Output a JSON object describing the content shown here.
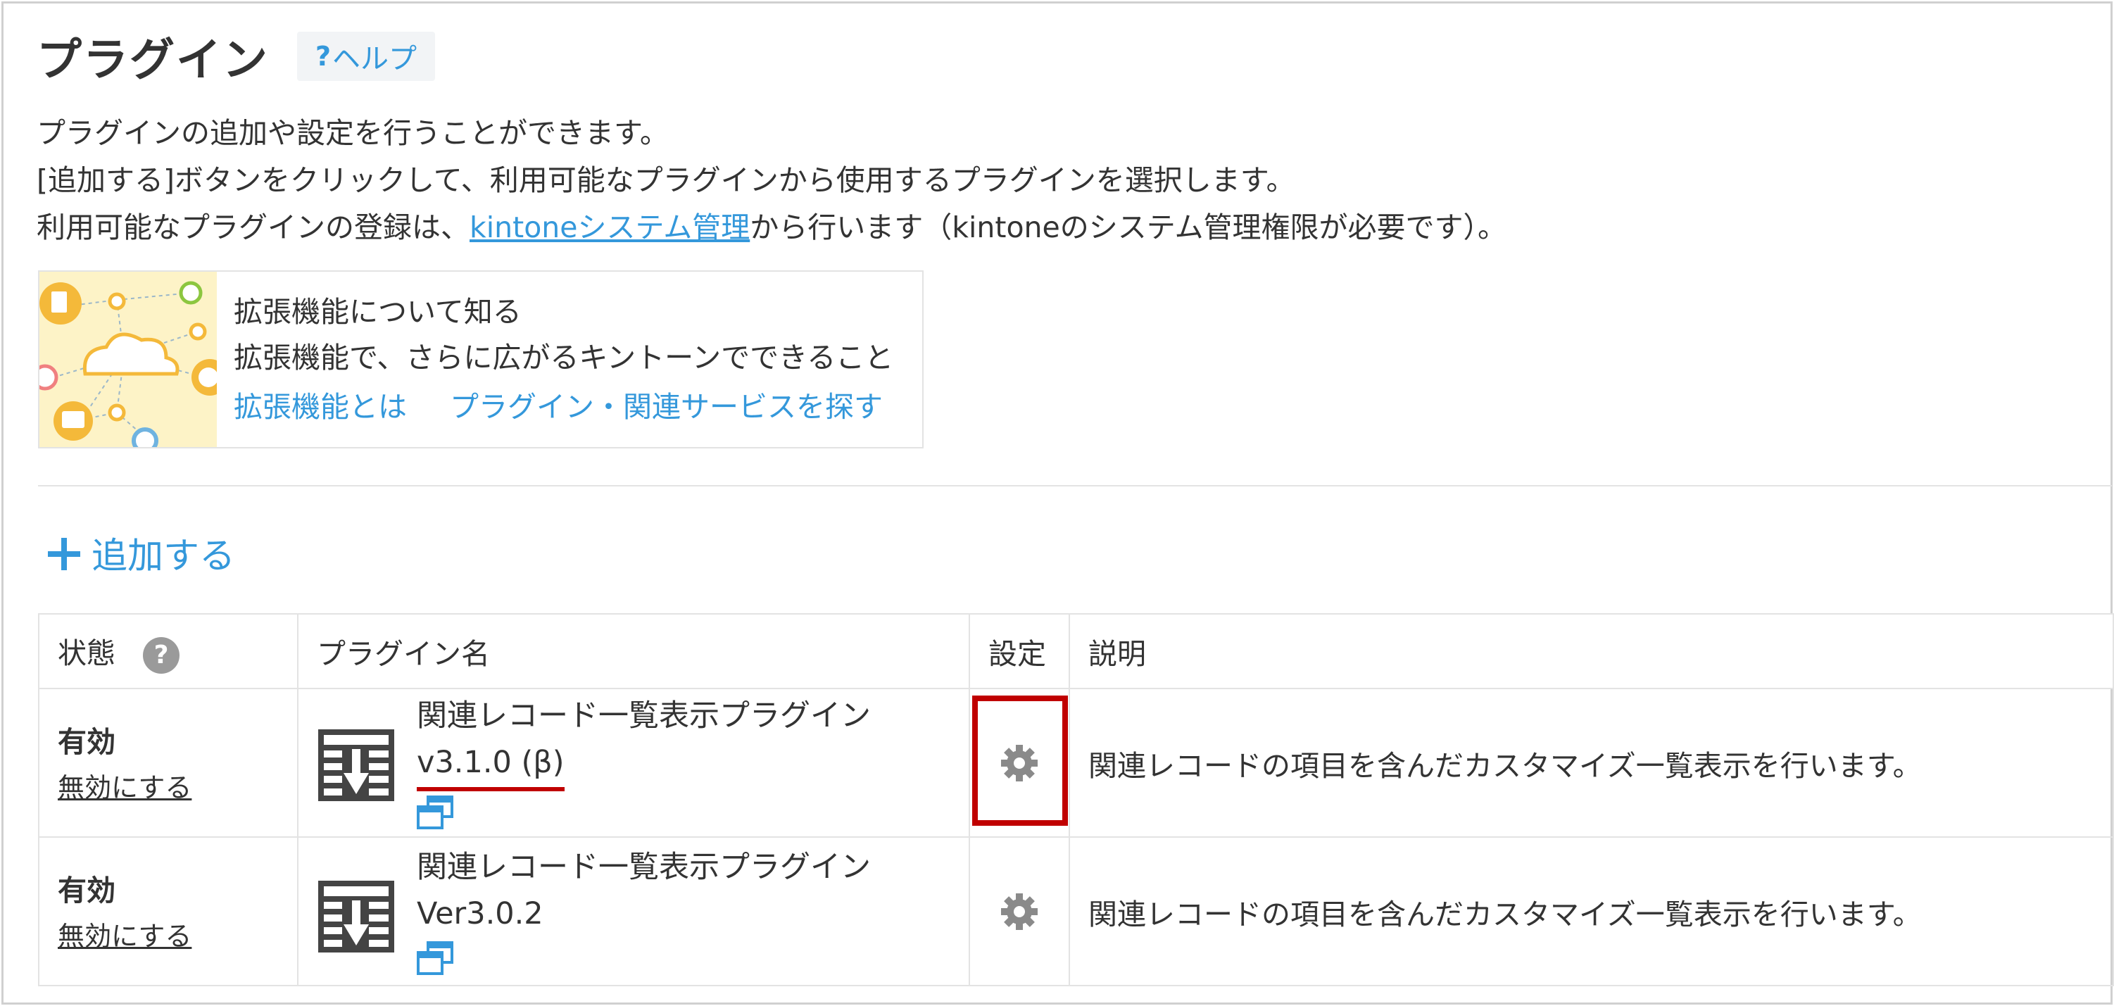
{
  "header": {
    "title": "プラグイン",
    "help_q": "?",
    "help_label": "ヘルプ"
  },
  "intro": {
    "line1": "プラグインの追加や設定を行うことができます。",
    "line2": "[追加する]ボタンをクリックして、利用可能なプラグインから使用するプラグインを選択します。",
    "line3_prefix": "利用可能なプラグインの登録は、",
    "line3_link": "kintoneシステム管理",
    "line3_suffix": "から行います（kintoneのシステム管理権限が必要です）。"
  },
  "extension": {
    "title": "拡張機能について知る",
    "subtitle": "拡張機能で、さらに広がるキントーンでできること",
    "link1": "拡張機能とは",
    "link2": "プラグイン・関連サービスを探す"
  },
  "add_button": {
    "label": "追加する"
  },
  "table": {
    "headers": {
      "status": "状態",
      "status_help": "?",
      "name": "プラグイン名",
      "setting": "設定",
      "description": "説明"
    },
    "rows": [
      {
        "status": "有効",
        "toggle": "無効にする",
        "name": "関連レコード一覧表示プラグイン",
        "version": "v3.1.0 (β)",
        "description": "関連レコードの項目を含んだカスタマイズ一覧表示を行います。"
      },
      {
        "status": "有効",
        "toggle": "無効にする",
        "name": "関連レコード一覧表示プラグイン",
        "version": "Ver3.0.2",
        "description": "関連レコードの項目を含んだカスタマイズ一覧表示を行います。"
      }
    ]
  },
  "colors": {
    "link": "#3498db",
    "highlight": "#c00000",
    "border": "#e3e3e3"
  },
  "icons": [
    "help-icon",
    "plus-icon",
    "plugin-icon",
    "popup-icon",
    "gear-icon"
  ]
}
